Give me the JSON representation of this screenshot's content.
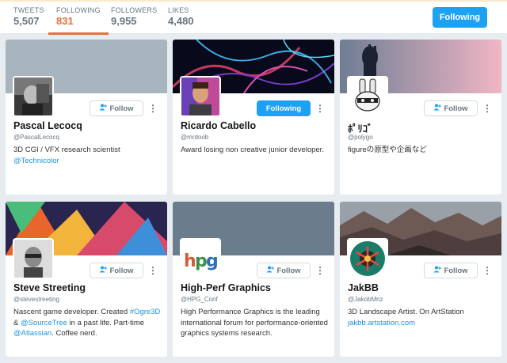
{
  "stats": [
    {
      "label": "TWEETS",
      "value": "5,507"
    },
    {
      "label": "FOLLOWING",
      "value": "831"
    },
    {
      "label": "FOLLOWERS",
      "value": "9,955"
    },
    {
      "label": "LIKES",
      "value": "4,480"
    }
  ],
  "header": {
    "following_button": "Following"
  },
  "colors": {
    "accent": "#1da1f2",
    "active_tab": "#e8703a",
    "link": "#1b95e0"
  },
  "cards": [
    {
      "name": "Pascal Lecocq",
      "handle": "@PascalLecocq",
      "bio_1": "3D CGI / VFX research scientist",
      "bio_link": "@Technicolor",
      "button": "Follow"
    },
    {
      "name": "Ricardo Cabello",
      "handle": "@mrdoob",
      "bio_1": "Award losing non creative junior developer.",
      "button": "Following"
    },
    {
      "name": "ﾎﾟﾘｺﾞ",
      "handle": "@polygo",
      "bio_1": "figureの原型や企画など",
      "button": "Follow"
    },
    {
      "name": "Steve Streeting",
      "handle": "@stevestreeting",
      "bio_a": "Nascent game developer. Created ",
      "bio_l1": "#Ogre3D",
      "bio_b": " & ",
      "bio_l2": "@SourceTree",
      "bio_c": " in a past life. Part-time ",
      "bio_l3": "@Atlassian",
      "bio_d": ". Coffee nerd.",
      "button": "Follow"
    },
    {
      "name": "High-Perf Graphics",
      "handle": "@HPG_Conf",
      "bio_1": "High Performance Graphics is the leading international forum for performance-oriented graphics systems research.",
      "button": "Follow"
    },
    {
      "name": "JakBB",
      "handle": "@JakobMnz",
      "bio_1": "3D Landscape Artist. On ArtStation",
      "bio_link": "jakbb.artstation.com",
      "button": "Follow"
    }
  ]
}
